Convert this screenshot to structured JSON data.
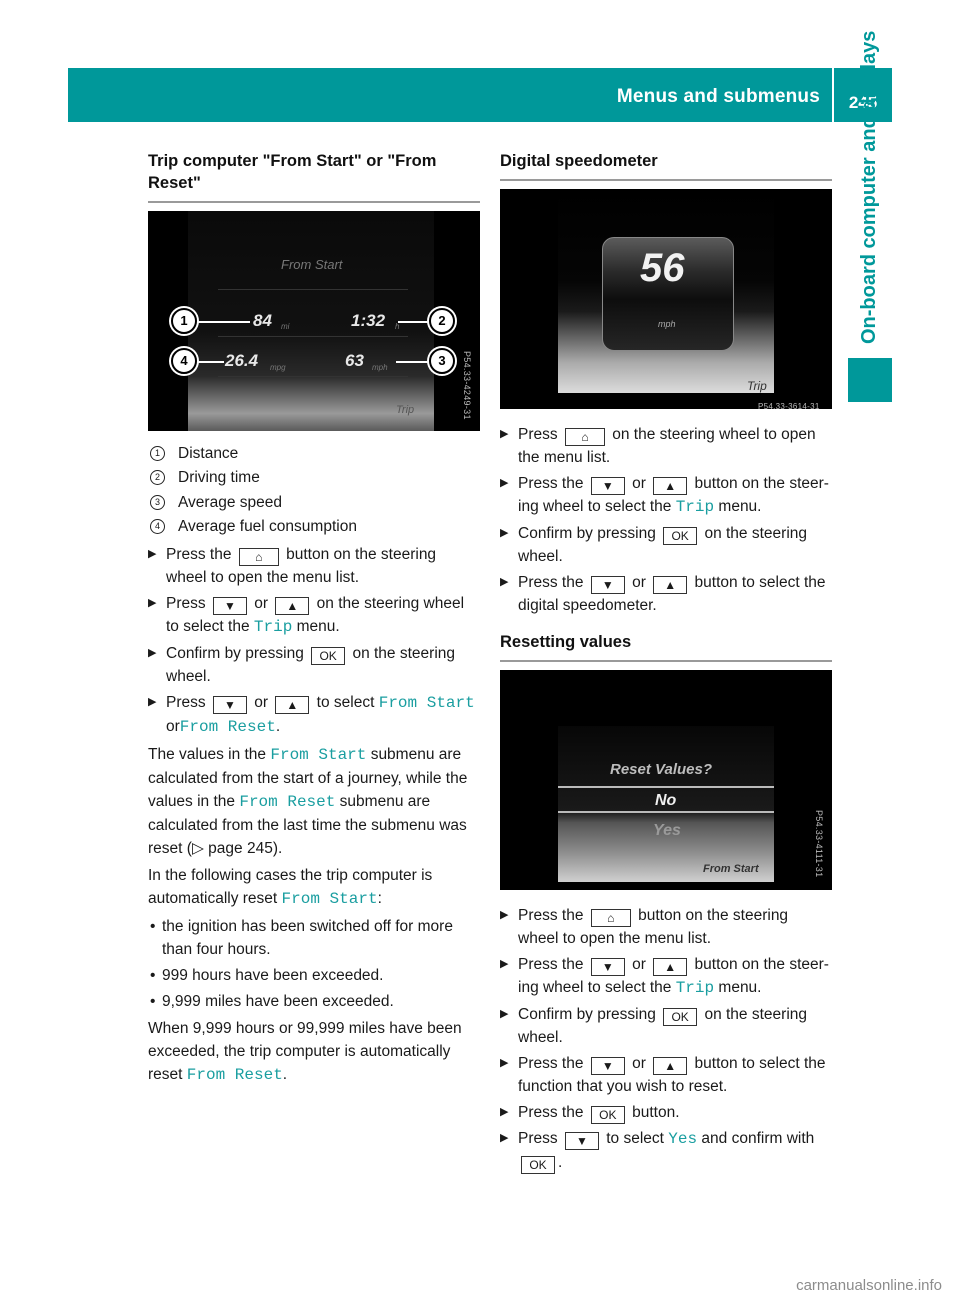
{
  "header": {
    "section_title": "Menus and submenus",
    "page_number": "245"
  },
  "side_tab": {
    "label": "On-board computer and displays"
  },
  "colors": {
    "accent": "#00989a",
    "menu_text": "#1a9ea0"
  },
  "left": {
    "heading": "Trip computer \"From Start\" or \"From Reset\"",
    "figure": {
      "screen_title": "From Start",
      "distance_value": "84",
      "distance_unit": "mi",
      "time_value": "1:32",
      "time_unit": "h",
      "fuel_value": "26.4",
      "fuel_unit": "mpg",
      "speed_value": "63",
      "speed_unit": "mph",
      "footer_label": "Trip",
      "code": "P54.33-4249-31",
      "callouts": [
        "1",
        "2",
        "3",
        "4"
      ]
    },
    "legend": [
      {
        "num": "1",
        "label": "Distance"
      },
      {
        "num": "2",
        "label": "Driving time"
      },
      {
        "num": "3",
        "label": "Average speed"
      },
      {
        "num": "4",
        "label": "Average fuel consumption"
      }
    ],
    "steps": {
      "s1_a": "Press the",
      "s1_key": "home-icon",
      "s1_b": "button on the steering wheel to open the menu list.",
      "s2_a": "Press",
      "s2_or": "or",
      "s2_b": "on the steering wheel to select the",
      "s2_menu": "Trip",
      "s2_c": "menu.",
      "s3_a": "Confirm by pressing",
      "s3_key": "OK",
      "s3_b": "on the steering wheel.",
      "s4_a": "Press",
      "s4_or": "or",
      "s4_b": "to select",
      "s4_m1": "From Start",
      "s4_c": "or",
      "s4_m2": "From Reset",
      "s4_d": "."
    },
    "para1": {
      "a": "The values in the",
      "m1": "From Start",
      "b": "submenu are calculated from the start of a journey, while the values in the",
      "m2": "From Reset",
      "c": "submenu are calculated from the last time the submenu was reset (",
      "ref_symbol": "▷",
      "ref": "page 245",
      "d": ")."
    },
    "para2": {
      "a": "In the following cases the trip computer is automatically reset",
      "m1": "From Start",
      "b": ":"
    },
    "bullets": [
      "the ignition has been switched off for more than four hours.",
      "999 hours have been exceeded.",
      "9,999 miles have been exceeded."
    ],
    "para3": {
      "a": "When 9,999 hours or 99,999 miles have been exceeded, the trip computer is automatically reset",
      "m1": "From Reset",
      "b": "."
    }
  },
  "right": {
    "speedo": {
      "heading": "Digital speedometer",
      "figure": {
        "speed": "56",
        "unit": "mph",
        "footer_label": "Trip",
        "code": "P54.33-3614-31"
      },
      "steps": {
        "s1_a": "Press",
        "s1_b": "on the steering wheel to open the menu list.",
        "s2_a": "Press the",
        "s2_or": "or",
        "s2_b": "button on the steer-ing wheel to select the",
        "s2_menu": "Trip",
        "s2_c": "menu.",
        "s3_a": "Confirm by pressing",
        "s3_key": "OK",
        "s3_b": "on the steering wheel.",
        "s4_a": "Press the",
        "s4_or": "or",
        "s4_b": "button to select the digital speedometer."
      }
    },
    "reset": {
      "heading": "Resetting values",
      "figure": {
        "prompt": "Reset Values?",
        "option_no": "No",
        "option_yes": "Yes",
        "footer_label": "From Start",
        "code": "P54.33-4111-31"
      },
      "steps": {
        "s1_a": "Press the",
        "s1_b": "button on the steering wheel to open the menu list.",
        "s2_a": "Press the",
        "s2_or": "or",
        "s2_b": "button on the steer-ing wheel to select the",
        "s2_menu": "Trip",
        "s2_c": "menu.",
        "s3_a": "Confirm by pressing",
        "s3_key": "OK",
        "s3_b": "on the steering wheel.",
        "s4_a": "Press the",
        "s4_or": "or",
        "s4_b": "button to select the function that you wish to reset.",
        "s5_a": "Press the",
        "s5_key": "OK",
        "s5_b": "button.",
        "s6_a": "Press",
        "s6_b": "to select",
        "s6_m": "Yes",
        "s6_c": "and confirm with",
        "s6_key": "OK",
        "s6_d": "."
      }
    }
  },
  "keys": {
    "down": "▼",
    "up": "▲",
    "home": "⌂",
    "bullet_arrow": "▶",
    "bullet_dot": "•"
  },
  "watermark": "carmanualsonline.info"
}
